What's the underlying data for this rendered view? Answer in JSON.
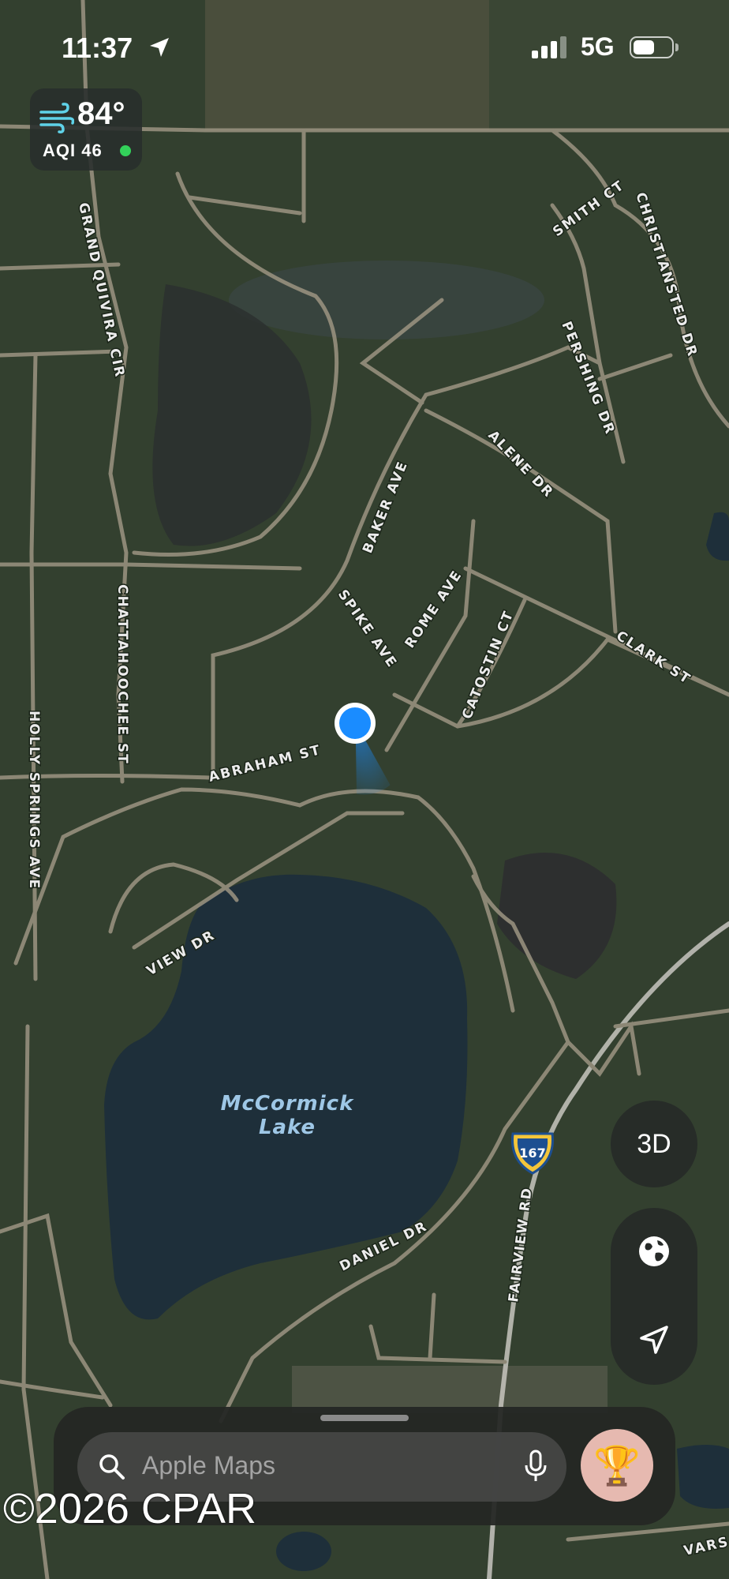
{
  "status_bar": {
    "time": "11:37",
    "network": "5G"
  },
  "weather": {
    "temperature": "84°",
    "aqi": "AQI 46"
  },
  "map": {
    "lake_name_line1": "McCormick",
    "lake_name_line2": "Lake",
    "roads": {
      "grand_quivira": "GRAND QUIVIRA CIR",
      "smith": "SMITH CT",
      "christiansted": "CHRISTIANSTED DR",
      "pershing": "PERSHING DR",
      "alene": "ALENE DR",
      "baker": "BAKER AVE",
      "spike": "SPIKE AVE",
      "rome": "ROME AVE",
      "catostin": "CATOSTIN CT",
      "clark": "CLARK ST",
      "chattahoochee": "CHATTAHOOCHEE ST",
      "holly_springs": "HOLLY SPRINGS AVE",
      "abraham": "ABRAHAM ST",
      "view": "VIEW DR",
      "daniel": "DANIEL DR",
      "fairview": "FAIRVIEW RD",
      "vars": "VARS"
    },
    "route_shield": "167"
  },
  "controls": {
    "three_d_label": "3D"
  },
  "search": {
    "placeholder": "Apple Maps",
    "avatar_emoji": "🏆"
  },
  "watermark": "©2026 CPAR",
  "colors": {
    "forest": "#2f3c2c",
    "water": "#1e2f3a",
    "road": "#9c9482",
    "user_location": "#1a8cff",
    "aqi_good": "#33d15a"
  }
}
